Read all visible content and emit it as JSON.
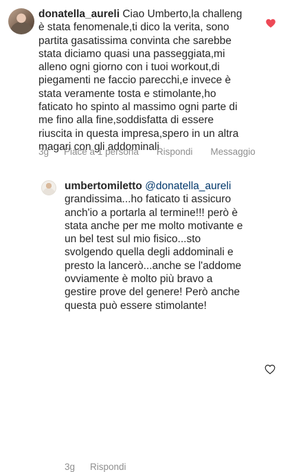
{
  "comments": [
    {
      "username": "donatella_aureli",
      "text": " Ciao Umberto,la challeng\nè stata fenomenale,ti dico la verita, sono\npartita gasatissima convinta che sarebbe\nstata diciamo quasi una passeggiata,mi\nalleno ogni giorno con i tuoi workout,di\npiegamenti ne faccio parecchi,e invece è\nstata veramente tosta e stimolante,ho\nfaticato ho spinto al massimo ogni parte di\nme fino alla fine,soddisfatta di essere\nriuscita in questa impresa,spero in un altra\nmagari con gli addominali",
      "time": "3g",
      "likes": "Piace a 1 persona",
      "reply": "Rispondi",
      "message": "Messaggio",
      "liked": true,
      "heart_color": "#ed4956"
    },
    {
      "username": "umbertomiletto",
      "mention": "@donatella_aureli",
      "text": "\ngrandissima...ho faticato ti assicuro\nanch'io a portarla al termine!!! però è\nstata anche per me molto motivante e\nun bel test sul mio fisico...sto\nsvolgendo quella degli addominali e\npresto la lancerò...anche se l'addome\novviamente è molto più bravo a\ngestire prove del genere! Però anche\nquesta può essere stimolante!",
      "time": "3g",
      "reply": "Rispondi",
      "liked": false
    }
  ],
  "icons": {
    "like": "heart-icon"
  }
}
